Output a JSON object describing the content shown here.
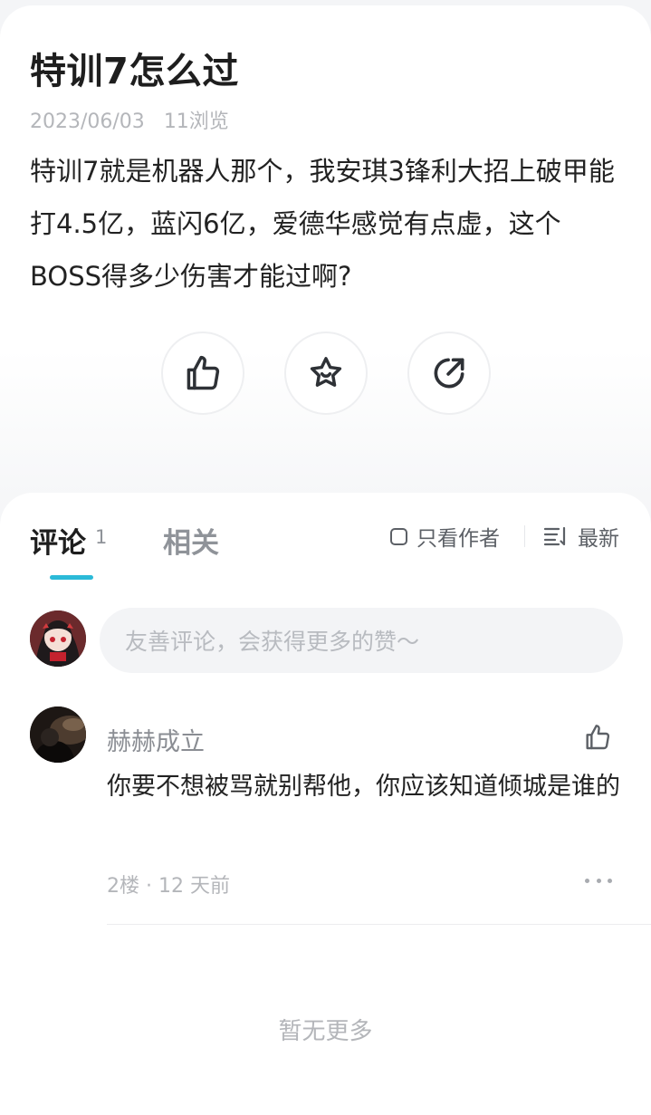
{
  "post": {
    "title": "特训7怎么过",
    "date": "2023/06/03",
    "views": "11浏览",
    "body": "特训7就是机器人那个，我安琪3锋利大招上破甲能打4.5亿，蓝闪6亿，爱德华感觉有点虚，这个BOSS得多少伤害才能过啊?"
  },
  "actions": [
    {
      "icon": "thumbs-up-icon"
    },
    {
      "icon": "star-icon"
    },
    {
      "icon": "share-icon"
    }
  ],
  "tabs": {
    "comments_label": "评论",
    "comments_count": "1",
    "related_label": "相关",
    "author_only_label": "只看作者",
    "sort_label": "最新"
  },
  "comment_input": {
    "placeholder": "友善评论，会获得更多的赞～"
  },
  "comments": [
    {
      "author": "赫赫成立",
      "text": "你要不想被骂就别帮他，你应该知道倾城是谁的",
      "meta": "2楼 · 12 天前"
    }
  ],
  "footer": {
    "no_more": "暂无更多"
  },
  "colors": {
    "accent": "#2bbad8",
    "muted_text": "#b4b6ba"
  }
}
